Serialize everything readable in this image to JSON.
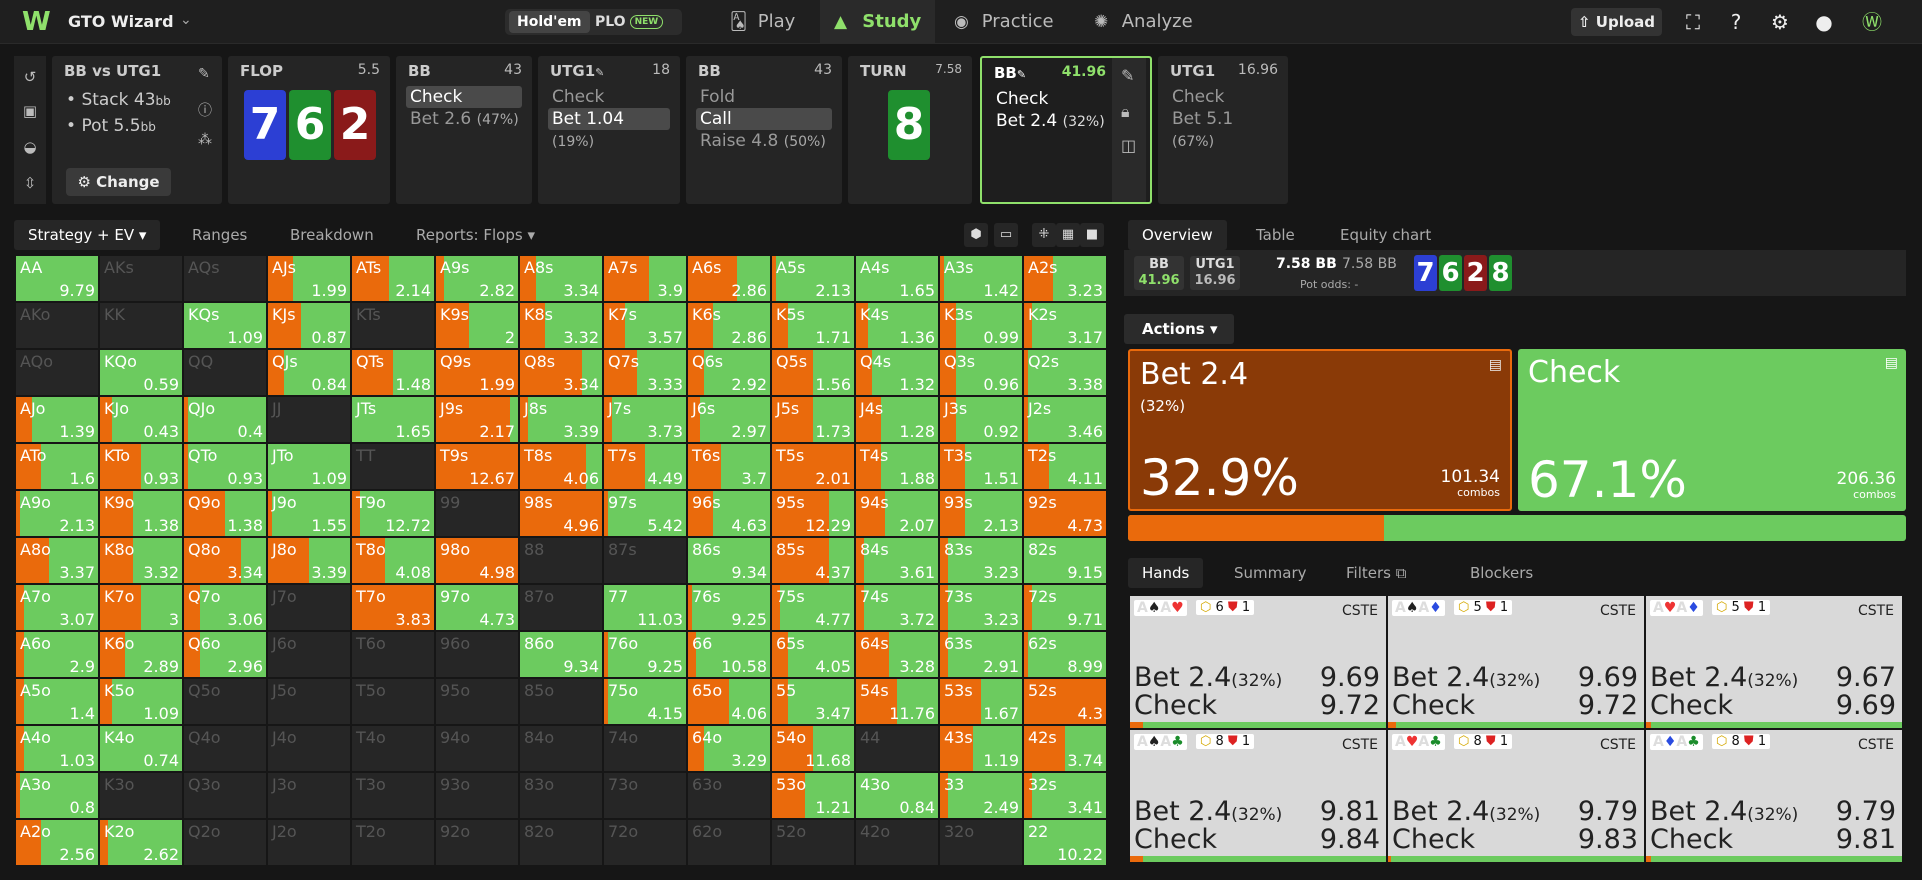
{
  "app": {
    "title": "GTO Wizard",
    "logo": "W"
  },
  "game_toggle": {
    "holdem": "Hold'em",
    "plo": "PLO",
    "plo_badge": "NEW"
  },
  "nav": [
    {
      "label": "Play",
      "icon": "cards-icon"
    },
    {
      "label": "Study",
      "icon": "study-hat-icon"
    },
    {
      "label": "Practice",
      "icon": "gamepad-icon"
    },
    {
      "label": "Analyze",
      "icon": "bulb-icon"
    }
  ],
  "upload_label": "Upload",
  "spot": {
    "title": "BB vs UTG1",
    "stack_label": "Stack 43",
    "pot_label": "Pot 5.5",
    "unit": "bb",
    "change_label": "Change"
  },
  "flop": {
    "title": "FLOP",
    "pot": "5.5",
    "cards": [
      {
        "rank": "7",
        "color": "#2c3fd4"
      },
      {
        "rank": "6",
        "color": "#1f8f2f"
      },
      {
        "rank": "2",
        "color": "#8a1a1a"
      }
    ]
  },
  "nodes": [
    {
      "player": "BB",
      "stack": "43",
      "actions": [
        {
          "label": "Check",
          "pct": "",
          "sel": true
        },
        {
          "label": "Bet 2.6",
          "pct": "(47%)",
          "sel": false
        }
      ]
    },
    {
      "player": "UTG1",
      "stack": "18",
      "actions": [
        {
          "label": "Check",
          "pct": "",
          "sel": false
        },
        {
          "label": "Bet 1.04",
          "pct": "(19%)",
          "sel": true
        }
      ]
    },
    {
      "player": "BB",
      "stack": "43",
      "actions": [
        {
          "label": "Fold",
          "pct": "",
          "sel": false
        },
        {
          "label": "Call",
          "pct": "",
          "sel": true
        },
        {
          "label": "Raise 4.8",
          "pct": "(50%)",
          "sel": false
        }
      ]
    }
  ],
  "turn": {
    "title": "TURN",
    "pot": "7.58",
    "card": {
      "rank": "8",
      "color": "#1f8f2f"
    }
  },
  "current_node": {
    "player": "BB",
    "stack": "41.96",
    "actions": [
      {
        "label": "Check",
        "pct": ""
      },
      {
        "label": "Bet 2.4",
        "pct": "(32%)"
      }
    ]
  },
  "next_node": {
    "player": "UTG1",
    "stack": "16.96",
    "actions": [
      {
        "label": "Check",
        "pct": ""
      },
      {
        "label": "Bet 5.1",
        "pct": "(67%)"
      }
    ]
  },
  "toolbar": {
    "tabs": [
      "Strategy + EV",
      "Ranges",
      "Breakdown",
      "Reports: Flops"
    ]
  },
  "colors": {
    "bet": "#ea6a0c",
    "check": "#6ccb5f",
    "empty": "#2a2a2a"
  },
  "grid": [
    [
      {
        "h": "AA",
        "v": "9.79",
        "b": 0
      },
      {
        "h": "AKs",
        "v": "",
        "b": -1
      },
      {
        "h": "AQs",
        "v": "",
        "b": -1
      },
      {
        "h": "AJs",
        "v": "1.99",
        "b": 0.3
      },
      {
        "h": "ATs",
        "v": "2.14",
        "b": 0.45
      },
      {
        "h": "A9s",
        "v": "2.82",
        "b": 0.1
      },
      {
        "h": "A8s",
        "v": "3.34",
        "b": 0.2
      },
      {
        "h": "A7s",
        "v": "3.9",
        "b": 0.55
      },
      {
        "h": "A6s",
        "v": "2.86",
        "b": 0.6
      },
      {
        "h": "A5s",
        "v": "2.13",
        "b": 0.05
      },
      {
        "h": "A4s",
        "v": "1.65",
        "b": 0
      },
      {
        "h": "A3s",
        "v": "1.42",
        "b": 0.05
      },
      {
        "h": "A2s",
        "v": "3.23",
        "b": 0.35
      }
    ],
    [
      {
        "h": "AKo",
        "v": "",
        "b": -1
      },
      {
        "h": "KK",
        "v": "",
        "b": -1
      },
      {
        "h": "KQs",
        "v": "1.09",
        "b": 0
      },
      {
        "h": "KJs",
        "v": "0.87",
        "b": 0.4
      },
      {
        "h": "KTs",
        "v": "",
        "b": -1
      },
      {
        "h": "K9s",
        "v": "2",
        "b": 0.4
      },
      {
        "h": "K8s",
        "v": "3.32",
        "b": 0.3
      },
      {
        "h": "K7s",
        "v": "3.57",
        "b": 0.25
      },
      {
        "h": "K6s",
        "v": "2.86",
        "b": 0.3
      },
      {
        "h": "K5s",
        "v": "1.71",
        "b": 0.2
      },
      {
        "h": "K4s",
        "v": "1.36",
        "b": 0.15
      },
      {
        "h": "K3s",
        "v": "0.99",
        "b": 0.2
      },
      {
        "h": "K2s",
        "v": "3.17",
        "b": 0.1
      }
    ],
    [
      {
        "h": "AQo",
        "v": "",
        "b": -1
      },
      {
        "h": "KQo",
        "v": "0.59",
        "b": 0
      },
      {
        "h": "QQ",
        "v": "",
        "b": -1
      },
      {
        "h": "QJs",
        "v": "0.84",
        "b": 0.2
      },
      {
        "h": "QTs",
        "v": "1.48",
        "b": 0.5
      },
      {
        "h": "Q9s",
        "v": "1.99",
        "b": 1
      },
      {
        "h": "Q8s",
        "v": "3.34",
        "b": 0.75
      },
      {
        "h": "Q7s",
        "v": "3.33",
        "b": 0.4
      },
      {
        "h": "Q6s",
        "v": "2.92",
        "b": 0.2
      },
      {
        "h": "Q5s",
        "v": "1.56",
        "b": 0.5
      },
      {
        "h": "Q4s",
        "v": "1.32",
        "b": 0.2
      },
      {
        "h": "Q3s",
        "v": "0.96",
        "b": 0.2
      },
      {
        "h": "Q2s",
        "v": "3.38",
        "b": 0.05
      }
    ],
    [
      {
        "h": "AJo",
        "v": "1.39",
        "b": 0.2
      },
      {
        "h": "KJo",
        "v": "0.43",
        "b": 0.15
      },
      {
        "h": "QJo",
        "v": "0.4",
        "b": 0.05
      },
      {
        "h": "JJ",
        "v": "",
        "b": -1
      },
      {
        "h": "JTs",
        "v": "1.65",
        "b": 0
      },
      {
        "h": "J9s",
        "v": "2.17",
        "b": 0.9
      },
      {
        "h": "J8s",
        "v": "3.39",
        "b": 0.1
      },
      {
        "h": "J7s",
        "v": "3.73",
        "b": 0.1
      },
      {
        "h": "J6s",
        "v": "2.97",
        "b": 0.15
      },
      {
        "h": "J5s",
        "v": "1.73",
        "b": 0.5
      },
      {
        "h": "J4s",
        "v": "1.28",
        "b": 0.3
      },
      {
        "h": "J3s",
        "v": "0.92",
        "b": 0.2
      },
      {
        "h": "J2s",
        "v": "3.46",
        "b": 0.05
      }
    ],
    [
      {
        "h": "ATo",
        "v": "1.6",
        "b": 0.3
      },
      {
        "h": "KTo",
        "v": "0.93",
        "b": 0.5
      },
      {
        "h": "QTo",
        "v": "0.93",
        "b": 0.05
      },
      {
        "h": "JTo",
        "v": "1.09",
        "b": 0
      },
      {
        "h": "TT",
        "v": "",
        "b": -1
      },
      {
        "h": "T9s",
        "v": "12.67",
        "b": 1
      },
      {
        "h": "T8s",
        "v": "4.06",
        "b": 0.8
      },
      {
        "h": "T7s",
        "v": "4.49",
        "b": 0.5
      },
      {
        "h": "T6s",
        "v": "3.7",
        "b": 0.4
      },
      {
        "h": "T5s",
        "v": "2.01",
        "b": 1
      },
      {
        "h": "T4s",
        "v": "1.88",
        "b": 0.3
      },
      {
        "h": "T3s",
        "v": "1.51",
        "b": 0.3
      },
      {
        "h": "T2s",
        "v": "4.11",
        "b": 0.3
      }
    ],
    [
      {
        "h": "A9o",
        "v": "2.13",
        "b": 0.05
      },
      {
        "h": "K9o",
        "v": "1.38",
        "b": 0.4
      },
      {
        "h": "Q9o",
        "v": "1.38",
        "b": 0.5
      },
      {
        "h": "J9o",
        "v": "1.55",
        "b": 0.05
      },
      {
        "h": "T9o",
        "v": "12.72",
        "b": 0.1
      },
      {
        "h": "99",
        "v": "",
        "b": -1
      },
      {
        "h": "98s",
        "v": "4.96",
        "b": 1
      },
      {
        "h": "97s",
        "v": "5.42",
        "b": 0.05
      },
      {
        "h": "96s",
        "v": "4.63",
        "b": 0.3
      },
      {
        "h": "95s",
        "v": "12.29",
        "b": 0.7
      },
      {
        "h": "94s",
        "v": "2.07",
        "b": 0.35
      },
      {
        "h": "93s",
        "v": "2.13",
        "b": 0.3
      },
      {
        "h": "92s",
        "v": "4.73",
        "b": 1
      }
    ],
    [
      {
        "h": "A8o",
        "v": "3.37",
        "b": 0.4
      },
      {
        "h": "K8o",
        "v": "3.32",
        "b": 0.4
      },
      {
        "h": "Q8o",
        "v": "3.34",
        "b": 0.7
      },
      {
        "h": "J8o",
        "v": "3.39",
        "b": 0.5
      },
      {
        "h": "T8o",
        "v": "4.08",
        "b": 0.4
      },
      {
        "h": "98o",
        "v": "4.98",
        "b": 1
      },
      {
        "h": "88",
        "v": "",
        "b": -1
      },
      {
        "h": "87s",
        "v": "",
        "b": -1
      },
      {
        "h": "86s",
        "v": "9.34",
        "b": 0
      },
      {
        "h": "85s",
        "v": "4.37",
        "b": 0.7
      },
      {
        "h": "84s",
        "v": "3.61",
        "b": 0.1
      },
      {
        "h": "83s",
        "v": "3.23",
        "b": 0.1
      },
      {
        "h": "82s",
        "v": "9.15",
        "b": 0
      }
    ],
    [
      {
        "h": "A7o",
        "v": "3.07",
        "b": 0.1
      },
      {
        "h": "K7o",
        "v": "3",
        "b": 0.5
      },
      {
        "h": "Q7o",
        "v": "3.06",
        "b": 0.2
      },
      {
        "h": "J7o",
        "v": "",
        "b": -1
      },
      {
        "h": "T7o",
        "v": "3.83",
        "b": 1
      },
      {
        "h": "97o",
        "v": "4.73",
        "b": 0
      },
      {
        "h": "87o",
        "v": "",
        "b": -1
      },
      {
        "h": "77",
        "v": "11.03",
        "b": 0
      },
      {
        "h": "76s",
        "v": "9.25",
        "b": 0.05
      },
      {
        "h": "75s",
        "v": "4.77",
        "b": 0.1
      },
      {
        "h": "74s",
        "v": "3.72",
        "b": 0.1
      },
      {
        "h": "73s",
        "v": "3.23",
        "b": 0.1
      },
      {
        "h": "72s",
        "v": "9.71",
        "b": 0.1
      }
    ],
    [
      {
        "h": "A6o",
        "v": "2.9",
        "b": 0.1
      },
      {
        "h": "K6o",
        "v": "2.89",
        "b": 0.3
      },
      {
        "h": "Q6o",
        "v": "2.96",
        "b": 0.2
      },
      {
        "h": "J6o",
        "v": "",
        "b": -1
      },
      {
        "h": "T6o",
        "v": "",
        "b": -1
      },
      {
        "h": "96o",
        "v": "",
        "b": -1
      },
      {
        "h": "86o",
        "v": "9.34",
        "b": 0
      },
      {
        "h": "76o",
        "v": "9.25",
        "b": 0.05
      },
      {
        "h": "66",
        "v": "10.58",
        "b": 0.1
      },
      {
        "h": "65s",
        "v": "4.05",
        "b": 0.2
      },
      {
        "h": "64s",
        "v": "3.28",
        "b": 0.4
      },
      {
        "h": "63s",
        "v": "2.91",
        "b": 0.1
      },
      {
        "h": "62s",
        "v": "8.99",
        "b": 0.05
      }
    ],
    [
      {
        "h": "A5o",
        "v": "1.4",
        "b": 0.1
      },
      {
        "h": "K5o",
        "v": "1.09",
        "b": 0.15
      },
      {
        "h": "Q5o",
        "v": "",
        "b": -1
      },
      {
        "h": "J5o",
        "v": "",
        "b": -1
      },
      {
        "h": "T5o",
        "v": "",
        "b": -1
      },
      {
        "h": "95o",
        "v": "",
        "b": -1
      },
      {
        "h": "85o",
        "v": "",
        "b": -1
      },
      {
        "h": "75o",
        "v": "4.15",
        "b": 0.05
      },
      {
        "h": "65o",
        "v": "4.06",
        "b": 0.5
      },
      {
        "h": "55",
        "v": "3.47",
        "b": 0.2
      },
      {
        "h": "54s",
        "v": "11.76",
        "b": 0.5
      },
      {
        "h": "53s",
        "v": "1.67",
        "b": 0.5
      },
      {
        "h": "52s",
        "v": "4.3",
        "b": 1
      }
    ],
    [
      {
        "h": "A4o",
        "v": "1.03",
        "b": 0.1
      },
      {
        "h": "K4o",
        "v": "0.74",
        "b": 0
      },
      {
        "h": "Q4o",
        "v": "",
        "b": -1
      },
      {
        "h": "J4o",
        "v": "",
        "b": -1
      },
      {
        "h": "T4o",
        "v": "",
        "b": -1
      },
      {
        "h": "94o",
        "v": "",
        "b": -1
      },
      {
        "h": "84o",
        "v": "",
        "b": -1
      },
      {
        "h": "74o",
        "v": "",
        "b": -1
      },
      {
        "h": "64o",
        "v": "3.29",
        "b": 0.2
      },
      {
        "h": "54o",
        "v": "11.68",
        "b": 0.5
      },
      {
        "h": "44",
        "v": "",
        "b": -1
      },
      {
        "h": "43s",
        "v": "1.19",
        "b": 0.4
      },
      {
        "h": "42s",
        "v": "3.74",
        "b": 0.5
      }
    ],
    [
      {
        "h": "A3o",
        "v": "0.8",
        "b": 0.05
      },
      {
        "h": "K3o",
        "v": "",
        "b": -1
      },
      {
        "h": "Q3o",
        "v": "",
        "b": -1
      },
      {
        "h": "J3o",
        "v": "",
        "b": -1
      },
      {
        "h": "T3o",
        "v": "",
        "b": -1
      },
      {
        "h": "93o",
        "v": "",
        "b": -1
      },
      {
        "h": "83o",
        "v": "",
        "b": -1
      },
      {
        "h": "73o",
        "v": "",
        "b": -1
      },
      {
        "h": "63o",
        "v": "",
        "b": -1
      },
      {
        "h": "53o",
        "v": "1.21",
        "b": 0.4
      },
      {
        "h": "43o",
        "v": "0.84",
        "b": 0
      },
      {
        "h": "33",
        "v": "2.49",
        "b": 0.1
      },
      {
        "h": "32s",
        "v": "3.41",
        "b": 0.1
      }
    ],
    [
      {
        "h": "A2o",
        "v": "2.56",
        "b": 0.3
      },
      {
        "h": "K2o",
        "v": "2.62",
        "b": 0.1
      },
      {
        "h": "Q2o",
        "v": "",
        "b": -1
      },
      {
        "h": "J2o",
        "v": "",
        "b": -1
      },
      {
        "h": "T2o",
        "v": "",
        "b": -1
      },
      {
        "h": "92o",
        "v": "",
        "b": -1
      },
      {
        "h": "82o",
        "v": "",
        "b": -1
      },
      {
        "h": "72o",
        "v": "",
        "b": -1
      },
      {
        "h": "62o",
        "v": "",
        "b": -1
      },
      {
        "h": "52o",
        "v": "",
        "b": -1
      },
      {
        "h": "42o",
        "v": "",
        "b": -1
      },
      {
        "h": "32o",
        "v": "",
        "b": -1
      },
      {
        "h": "22",
        "v": "10.22",
        "b": 0
      }
    ]
  ],
  "right_tabs": [
    "Overview",
    "Table",
    "Equity chart"
  ],
  "info": {
    "p1": "BB",
    "p1v": "41.96",
    "p2": "UTG1",
    "p2v": "16.96",
    "pot": "7.58 BB",
    "pot2": "7.58 BB",
    "pot_odds_label": "Pot odds:",
    "pot_odds": "-",
    "board": [
      {
        "rank": "7",
        "color": "#2c3fd4"
      },
      {
        "rank": "6",
        "color": "#1f8f2f"
      },
      {
        "rank": "2",
        "color": "#8a1a1a"
      },
      {
        "rank": "8",
        "color": "#1f8f2f"
      }
    ]
  },
  "actions_label": "Actions",
  "action_boxes": [
    {
      "label": "Bet 2.4",
      "sub": "(32%)",
      "pct": "32.9%",
      "combos": "101.34",
      "combos_label": "combos",
      "color": "#8a3a07"
    },
    {
      "label": "Check",
      "sub": "",
      "pct": "67.1%",
      "combos": "206.36",
      "combos_label": "combos",
      "color": "#6ccb5f"
    }
  ],
  "bet_freq": 0.329,
  "hand_tabs": [
    "Hands",
    "Summary",
    "Filters",
    "Blockers"
  ],
  "hand_cards": [
    {
      "c1": "A",
      "s1": "♠",
      "k1": "sk",
      "c2": "A",
      "s2": "♥",
      "k2": "sr",
      "n": "6",
      "m": "1",
      "tag": "CSTE",
      "r1": "Bet 2.4",
      "r1p": "(32%)",
      "v1": "9.69",
      "r2": "Check",
      "v2": "9.72",
      "bf": 0.05
    },
    {
      "c1": "A",
      "s1": "♠",
      "k1": "sk",
      "c2": "A",
      "s2": "♦",
      "k2": "sb",
      "n": "5",
      "m": "1",
      "tag": "CSTE",
      "r1": "Bet 2.4",
      "r1p": "(32%)",
      "v1": "9.69",
      "r2": "Check",
      "v2": "9.72",
      "bf": 0.03
    },
    {
      "c1": "A",
      "s1": "♥",
      "k1": "sr",
      "c2": "A",
      "s2": "♦",
      "k2": "sb",
      "n": "5",
      "m": "1",
      "tag": "CSTE",
      "r1": "Bet 2.4",
      "r1p": "(32%)",
      "v1": "9.67",
      "r2": "Check",
      "v2": "9.69",
      "bf": 0.02
    },
    {
      "c1": "A",
      "s1": "♠",
      "k1": "sk",
      "c2": "A",
      "s2": "♣",
      "k2": "sg",
      "n": "8",
      "m": "1",
      "tag": "CSTE",
      "r1": "Bet 2.4",
      "r1p": "(32%)",
      "v1": "9.81",
      "r2": "Check",
      "v2": "9.84",
      "bf": 0.05
    },
    {
      "c1": "A",
      "s1": "♥",
      "k1": "sr",
      "c2": "A",
      "s2": "♣",
      "k2": "sg",
      "n": "8",
      "m": "1",
      "tag": "CSTE",
      "r1": "Bet 2.4",
      "r1p": "(32%)",
      "v1": "9.79",
      "r2": "Check",
      "v2": "9.83",
      "bf": 0.01
    },
    {
      "c1": "A",
      "s1": "♦",
      "k1": "sb",
      "c2": "A",
      "s2": "♣",
      "k2": "sg",
      "n": "8",
      "m": "1",
      "tag": "CSTE",
      "r1": "Bet 2.4",
      "r1p": "(32%)",
      "v1": "9.79",
      "r2": "Check",
      "v2": "9.81",
      "bf": 0.02
    }
  ]
}
